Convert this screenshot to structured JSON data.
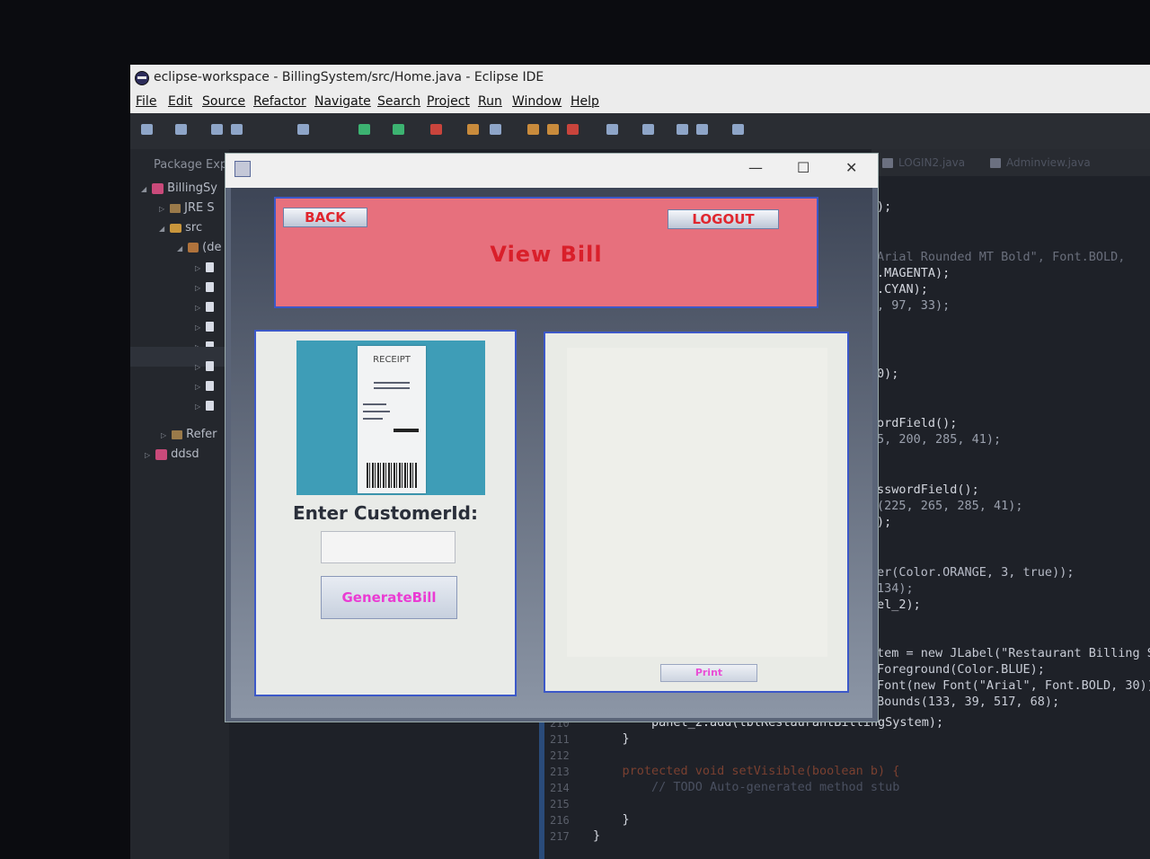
{
  "eclipse": {
    "title": "eclipse-workspace - BillingSystem/src/Home.java - Eclipse IDE",
    "menu": [
      "File",
      "Edit",
      "Source",
      "Refactor",
      "Navigate",
      "Search",
      "Project",
      "Run",
      "Window",
      "Help"
    ]
  },
  "package_explorer": {
    "title": "Package Exp",
    "project": "BillingSy",
    "jre": "JRE S",
    "src": "src",
    "default_pkg": "(de",
    "referenced": "Refer",
    "other_project": "ddsd"
  },
  "editor": {
    "tabs": [
      "LOGIN2.java",
      "Adminview.java"
    ],
    "lines_right": [
      ");",
      "Arial Rounded MT Bold\", Font.BOLD,",
      ".MAGENTA);",
      ".CYAN);",
      ", 97, 33);",
      "0);",
      "ordField();",
      "5, 200, 285, 41);",
      "sswordField();",
      "(225, 265, 285, 41);",
      ");",
      "er(Color.ORANGE, 3, true));",
      "134);",
      "el_2);",
      "tem = new JLabel(\"Restaurant Billing S",
      "Foreground(Color.BLUE);",
      "Font(new Font(\"Arial\", Font.BOLD, 30))",
      "Bounds(133, 39, 517, 68);"
    ],
    "bottom_lines": [
      {
        "num": "210",
        "code": "        panel_2.add(lblRestaurantBillingSystem);"
      },
      {
        "num": "211",
        "code": "    }"
      },
      {
        "num": "212",
        "code": ""
      },
      {
        "num": "213",
        "code": "    protected void setVisible(boolean b) {"
      },
      {
        "num": "214",
        "code": "        // TODO Auto-generated method stub"
      },
      {
        "num": "215",
        "code": ""
      },
      {
        "num": "216",
        "code": "    }"
      },
      {
        "num": "217",
        "code": "}"
      }
    ]
  },
  "dialog": {
    "back_label": "BACK",
    "logout_label": "LOGOUT",
    "title": "View Bill",
    "receipt_text": "RECEIPT",
    "customer_label": "Enter CustomerId:",
    "customer_value": "",
    "generate_label": "GenerateBill",
    "print_label": "Print",
    "colors": {
      "header_bg": "#e7707d",
      "header_border": "#3c58c8",
      "title_red": "#d91f2a",
      "button_magenta": "#ea3bd3",
      "receipt_bg": "#3e9db7"
    }
  }
}
